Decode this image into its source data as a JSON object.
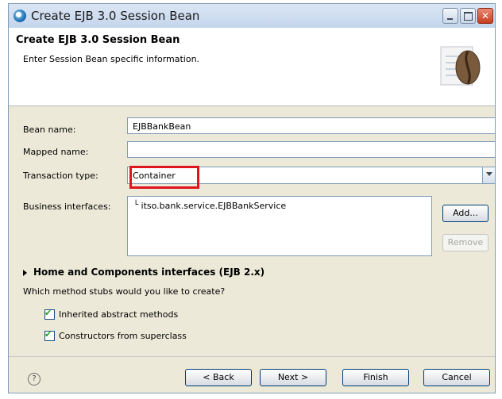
{
  "window": {
    "title": "Create EJB 3.0 Session Bean"
  },
  "header": {
    "title": "Create EJB 3.0 Session Bean",
    "subtitle": "Enter Session Bean specific information."
  },
  "form": {
    "bean_name": {
      "label": "Bean name:",
      "value": "EJBBankBean"
    },
    "mapped_name": {
      "label": "Mapped name:",
      "value": ""
    },
    "transaction_type": {
      "label": "Transaction type:",
      "value": "Container"
    },
    "business_interfaces": {
      "label": "Business interfaces:",
      "items": [
        "itso.bank.service.EJBBankService"
      ]
    }
  },
  "buttons": {
    "add": "Add...",
    "remove": "Remove",
    "back": "< Back",
    "next": "Next >",
    "finish": "Finish",
    "cancel": "Cancel"
  },
  "section": {
    "label": "Home and Components interfaces (EJB 2.x)"
  },
  "stubs": {
    "question": "Which method stubs would you like to create?",
    "options": [
      {
        "label": "Inherited abstract methods",
        "checked": true
      },
      {
        "label": "Constructors from superclass",
        "checked": true
      }
    ]
  },
  "icons": {
    "help": "?",
    "app": "ejb-wizard-icon",
    "bean": "coffee-bean-icon"
  },
  "colors": {
    "highlight": "#e0141b",
    "check": "#21a121"
  }
}
